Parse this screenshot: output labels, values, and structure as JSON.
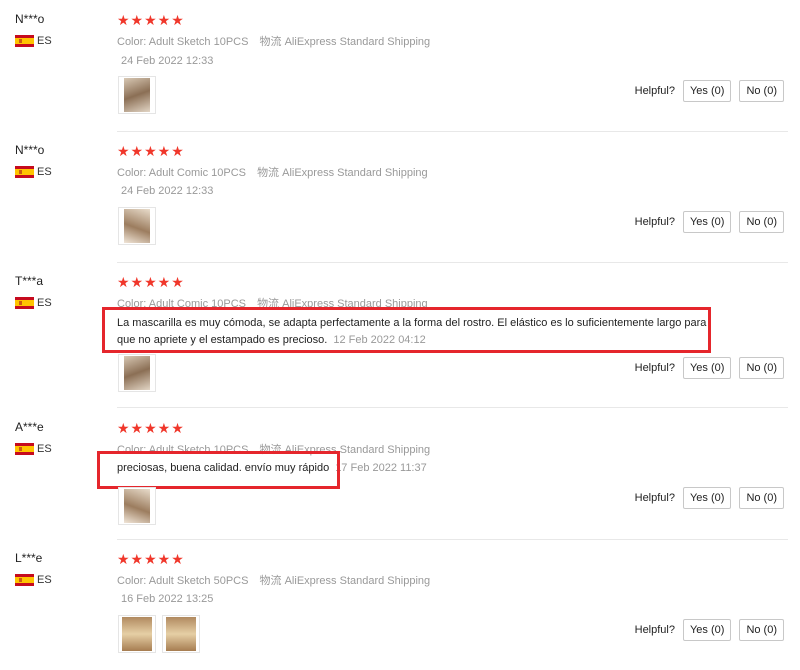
{
  "helpful_label": "Helpful?",
  "yes_label": "Yes (0)",
  "no_label": "No (0)",
  "rating": "★★★★★",
  "country_code": "ES",
  "shipping_prefix": "物流",
  "shipping": "AliExpress Standard Shipping",
  "reviews": [
    {
      "user": "N***o",
      "color": "Color: Adult Sketch 10PCS",
      "date": "24 Feb 2022 12:33",
      "feedback": "",
      "feedback_date": ""
    },
    {
      "user": "N***o",
      "color": "Color: Adult Comic 10PCS",
      "date": "24 Feb 2022 12:33",
      "feedback": "",
      "feedback_date": ""
    },
    {
      "user": "T***a",
      "color": "Color: Adult Comic 10PCS",
      "date": "",
      "feedback": "La mascarilla es muy cómoda, se adapta perfectamente a la forma del rostro. El elástico es lo suficientemente largo para que no apriete y el estampado es precioso.",
      "feedback_date": "12 Feb 2022 04:12"
    },
    {
      "user": "A***e",
      "color": "Color: Adult Sketch 10PCS",
      "date": "",
      "feedback": "preciosas, buena calidad. envío muy rápido",
      "feedback_date": "17 Feb 2022 11:37"
    },
    {
      "user": "L***e",
      "color": "Color: Adult Sketch 50PCS",
      "date": "16 Feb 2022 13:25",
      "feedback": "",
      "feedback_date": ""
    }
  ],
  "colors": {
    "star": "#f0372b",
    "highlight": "#e5262c",
    "muted": "#999999"
  }
}
